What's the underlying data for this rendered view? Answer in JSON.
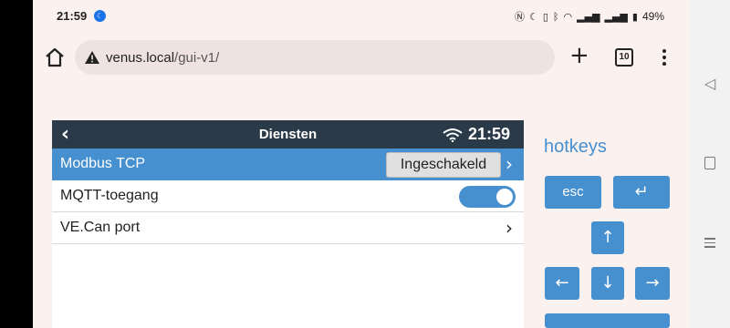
{
  "status_bar": {
    "time": "21:59",
    "battery": "49%"
  },
  "browser": {
    "url_host": "venus.local",
    "url_path": "/gui-v1/",
    "tab_count": "10"
  },
  "device": {
    "header_title": "Diensten",
    "header_time": "21:59",
    "rows": [
      {
        "label": "Modbus TCP",
        "value": "Ingeschakeld"
      },
      {
        "label": "MQTT-toegang"
      },
      {
        "label": "VE.Can port"
      }
    ]
  },
  "hotkeys": {
    "title": "hotkeys",
    "esc_label": "esc",
    "enter_icon": "↵",
    "up_icon": "↑",
    "left_icon": "←",
    "down_icon": "↓",
    "right_icon": "→"
  },
  "colors": {
    "accent": "#4790d0",
    "header_bg": "#2b3a49"
  }
}
